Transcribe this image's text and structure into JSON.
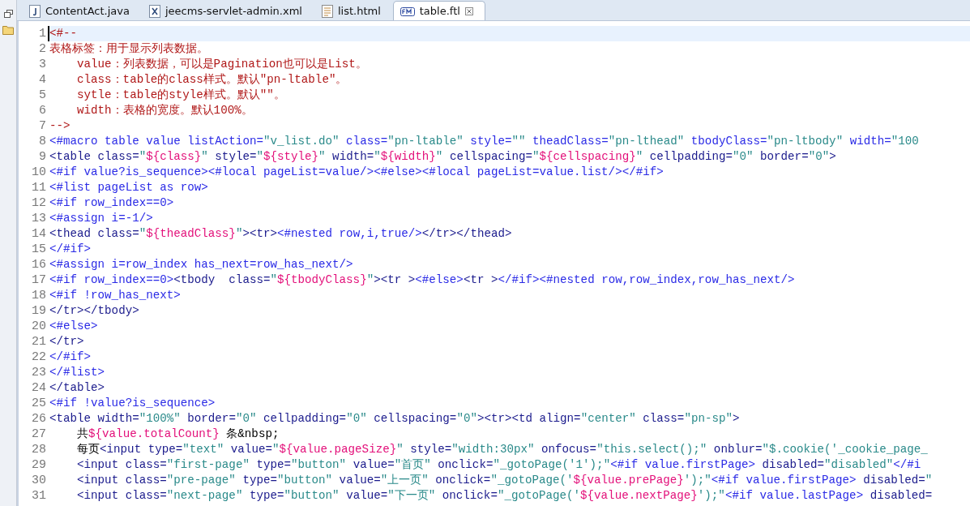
{
  "tabs": [
    {
      "label": "ContentAct.java",
      "kind": "java",
      "selected": false
    },
    {
      "label": "jeecms-servlet-admin.xml",
      "kind": "xml",
      "selected": false
    },
    {
      "label": "list.html",
      "kind": "html",
      "selected": false
    },
    {
      "label": "table.ftl",
      "kind": "ftl",
      "selected": true
    }
  ],
  "lines": [
    {
      "number": "1",
      "kind": "comment",
      "current": true,
      "text": "<#--"
    },
    {
      "number": "2",
      "kind": "comment",
      "current": false,
      "text": "表格标签：用于显示列表数据。"
    },
    {
      "number": "3",
      "kind": "comment",
      "current": false,
      "text": "    value：列表数据，可以是Pagination也可以是List。"
    },
    {
      "number": "4",
      "kind": "comment",
      "current": false,
      "text": "    class：table的class样式。默认\"pn-ltable\"。"
    },
    {
      "number": "5",
      "kind": "comment",
      "current": false,
      "text": "    sytle：table的style样式。默认\"\"。"
    },
    {
      "number": "6",
      "kind": "comment",
      "current": false,
      "text": "    width：表格的宽度。默认100%。"
    },
    {
      "number": "7",
      "kind": "comment",
      "current": false,
      "text": "-->"
    },
    {
      "number": "8",
      "kind": "code",
      "current": false,
      "text": "<#macro table value listAction=\"v_list.do\" class=\"pn-ltable\" style=\"\" theadClass=\"pn-lthead\" tbodyClass=\"pn-ltbody\" width=\"100"
    },
    {
      "number": "9",
      "kind": "code",
      "current": false,
      "text": "<table class=\"${class}\" style=\"${style}\" width=\"${width}\" cellspacing=\"${cellspacing}\" cellpadding=\"0\" border=\"0\">"
    },
    {
      "number": "10",
      "kind": "code",
      "current": false,
      "text": "<#if value?is_sequence><#local pageList=value/><#else><#local pageList=value.list/></#if>"
    },
    {
      "number": "11",
      "kind": "code",
      "current": false,
      "text": "<#list pageList as row>"
    },
    {
      "number": "12",
      "kind": "code",
      "current": false,
      "text": "<#if row_index==0>"
    },
    {
      "number": "13",
      "kind": "code",
      "current": false,
      "text": "<#assign i=-1/>"
    },
    {
      "number": "14",
      "kind": "code",
      "current": false,
      "text": "<thead class=\"${theadClass}\"><tr><#nested row,i,true/></tr></thead>"
    },
    {
      "number": "15",
      "kind": "code",
      "current": false,
      "text": "</#if>"
    },
    {
      "number": "16",
      "kind": "code",
      "current": false,
      "text": "<#assign i=row_index has_next=row_has_next/>"
    },
    {
      "number": "17",
      "kind": "code",
      "current": false,
      "text": "<#if row_index==0><tbody  class=\"${tbodyClass}\"><tr ><#else><tr ></#if><#nested row,row_index,row_has_next/>"
    },
    {
      "number": "18",
      "kind": "code",
      "current": false,
      "text": "<#if !row_has_next>"
    },
    {
      "number": "19",
      "kind": "code",
      "current": false,
      "text": "</tr></tbody>"
    },
    {
      "number": "20",
      "kind": "code",
      "current": false,
      "text": "<#else>"
    },
    {
      "number": "21",
      "kind": "code",
      "current": false,
      "text": "</tr>"
    },
    {
      "number": "22",
      "kind": "code",
      "current": false,
      "text": "</#if>"
    },
    {
      "number": "23",
      "kind": "code",
      "current": false,
      "text": "</#list>"
    },
    {
      "number": "24",
      "kind": "code",
      "current": false,
      "text": "</table>"
    },
    {
      "number": "25",
      "kind": "code",
      "current": false,
      "text": "<#if !value?is_sequence>"
    },
    {
      "number": "26",
      "kind": "code",
      "current": false,
      "text": "<table width=\"100%\" border=\"0\" cellpadding=\"0\" cellspacing=\"0\"><tr><td align=\"center\" class=\"pn-sp\">"
    },
    {
      "number": "27",
      "kind": "code",
      "current": false,
      "text": "    共${value.totalCount} 条&nbsp;"
    },
    {
      "number": "28",
      "kind": "code",
      "current": false,
      "text": "    每页<input type=\"text\" value=\"${value.pageSize}\" style=\"width:30px\" onfocus=\"this.select();\" onblur=\"$.cookie('_cookie_page_"
    },
    {
      "number": "29",
      "kind": "code",
      "current": false,
      "text": "    <input class=\"first-page\" type=\"button\" value=\"首页\" onclick=\"_gotoPage('1');\"<#if value.firstPage> disabled=\"disabled\"</#i"
    },
    {
      "number": "30",
      "kind": "code",
      "current": false,
      "text": "    <input class=\"pre-page\" type=\"button\" value=\"上一页\" onclick=\"_gotoPage('${value.prePage}');\"<#if value.firstPage> disabled=\""
    },
    {
      "number": "31",
      "kind": "code",
      "current": false,
      "text": "    <input class=\"next-page\" type=\"button\" value=\"下一页\" onclick=\"_gotoPage('${value.nextPage}');\"<#if value.lastPage> disabled="
    }
  ]
}
